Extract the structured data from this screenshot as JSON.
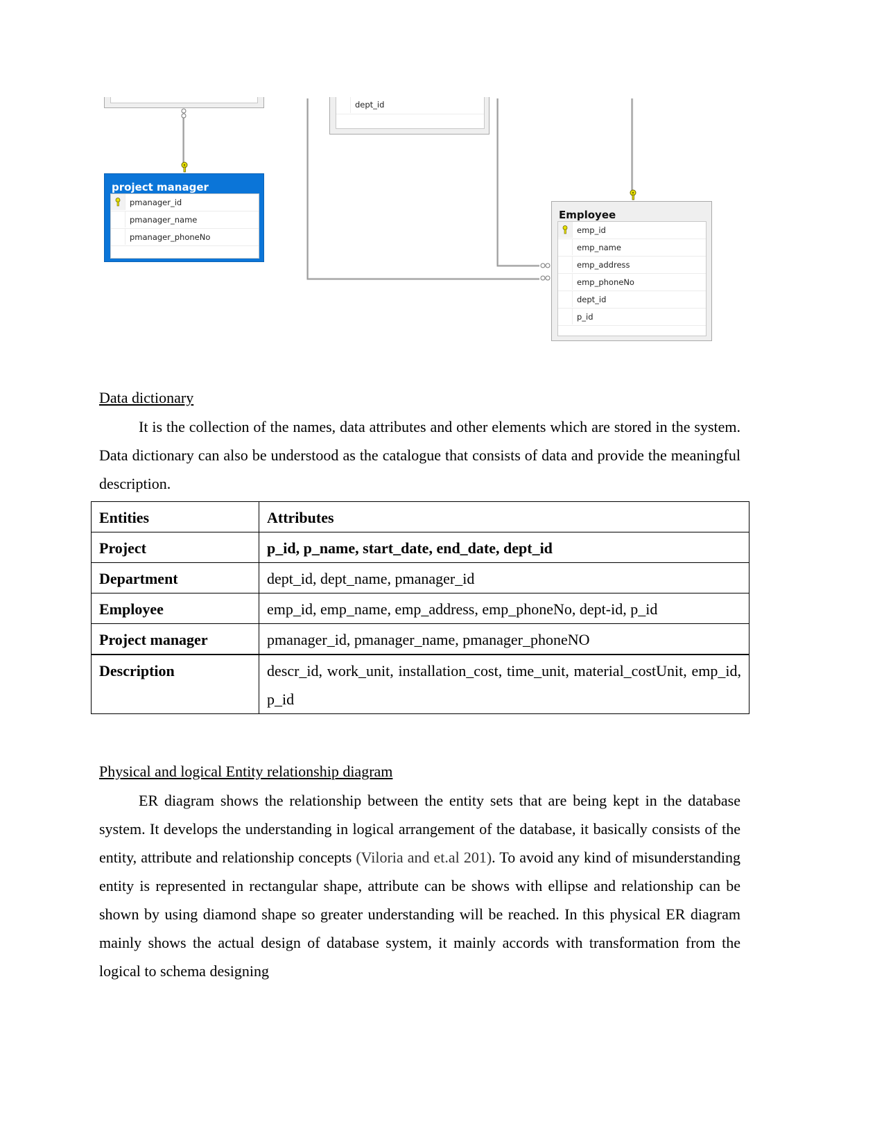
{
  "diagram": {
    "top_left_table": {
      "fields": []
    },
    "department_table": {
      "fields": [
        "dept_id"
      ]
    },
    "project_manager_table": {
      "title": "project manager",
      "header_color": "#0b75d8",
      "fields": [
        {
          "name": "pmanager_id",
          "primary_key": true
        },
        {
          "name": "pmanager_name",
          "primary_key": false
        },
        {
          "name": "pmanager_phoneNo",
          "primary_key": false
        }
      ]
    },
    "employee_table": {
      "title": "Employee",
      "fields": [
        {
          "name": "emp_id",
          "primary_key": true
        },
        {
          "name": "emp_name",
          "primary_key": false
        },
        {
          "name": "emp_address",
          "primary_key": false
        },
        {
          "name": "emp_phoneNo",
          "primary_key": false
        },
        {
          "name": "dept_id",
          "primary_key": false
        },
        {
          "name": "p_id",
          "primary_key": false
        }
      ]
    },
    "key_icon_color": "#e8e200"
  },
  "section1": {
    "heading": "Data dictionary",
    "paragraph": "It is the collection of the names, data attributes and other elements which are stored in the system. Data dictionary can also be understood as the catalogue that consists of data and provide the meaningful description."
  },
  "dictionary_table": {
    "headers": [
      "Entities",
      "Attributes"
    ],
    "rows": [
      {
        "entity": "Project",
        "attributes": "p_id, p_name, start_date, end_date, dept_id"
      },
      {
        "entity": "Department",
        "attributes": "dept_id, dept_name, pmanager_id"
      },
      {
        "entity": "Employee",
        "attributes": "emp_id, emp_name, emp_address, emp_phoneNo, dept-id, p_id"
      },
      {
        "entity": "Project manager",
        "attributes": "pmanager_id, pmanager_name, pmanager_phoneNO"
      },
      {
        "entity": "Description",
        "attributes": "descr_id, work_unit, installation_cost, time_unit, material_costUnit, emp_id, p_id"
      }
    ]
  },
  "section2": {
    "heading": "Physical and logical Entity relationship diagram",
    "paragraph_part1": "ER diagram shows the relationship between the entity sets that are being kept in the database system. It develops the understanding in logical arrangement of the database, it basically consists of the entity, attribute and relationship concepts ",
    "citation": "(Viloria and et.al 201)",
    "paragraph_part2": ". To avoid any kind of misunderstanding entity is represented in rectangular shape, attribute can be shows with ellipse and relationship can be shown by using diamond shape so greater understanding will be reached. In this physical ER diagram mainly shows the actual design of database system, it mainly accords with transformation from the logical to schema designing"
  }
}
